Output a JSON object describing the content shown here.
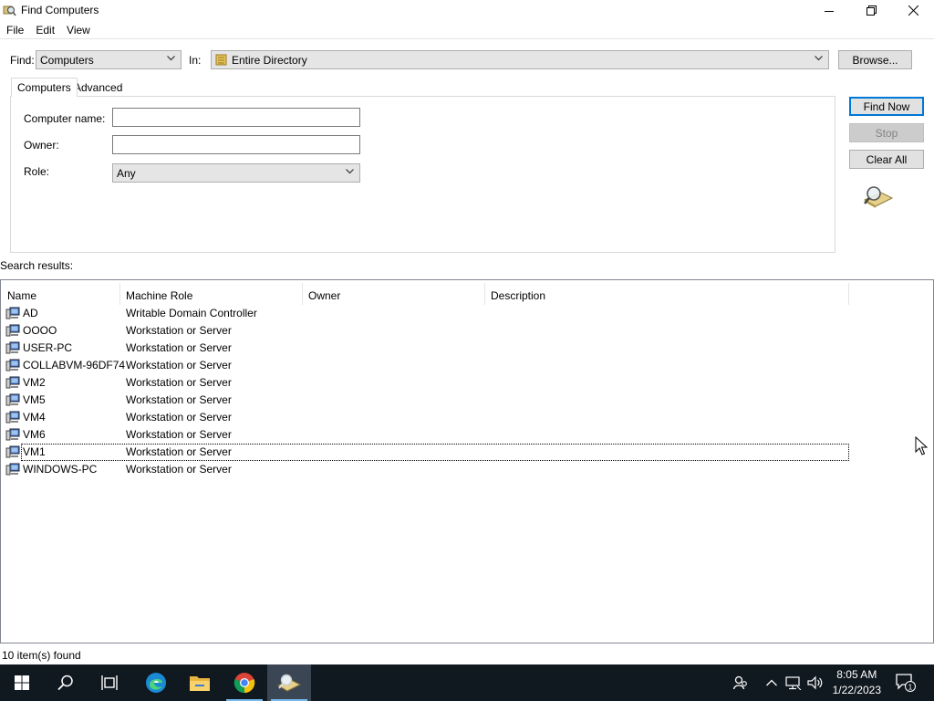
{
  "window": {
    "title": "Find Computers"
  },
  "menu": [
    "File",
    "Edit",
    "View"
  ],
  "find_row": {
    "find_label": "Find:",
    "find_value": "Computers",
    "in_label": "In:",
    "in_value": "Entire Directory",
    "browse_label": "Browse..."
  },
  "tabs": [
    "Computers",
    "Advanced"
  ],
  "form": {
    "computer_name_label": "Computer name:",
    "computer_name_value": "",
    "owner_label": "Owner:",
    "owner_value": "",
    "role_label": "Role:",
    "role_value": "Any"
  },
  "actions": {
    "find_now": "Find Now",
    "stop": "Stop",
    "clear_all": "Clear All"
  },
  "results": {
    "label": "Search results:",
    "columns": [
      "Name",
      "Machine Role",
      "Owner",
      "Description"
    ],
    "rows": [
      {
        "name": "AD",
        "role": "Writable Domain Controller"
      },
      {
        "name": "OOOO",
        "role": "Workstation or Server"
      },
      {
        "name": "USER-PC",
        "role": "Workstation or Server"
      },
      {
        "name": "COLLABVM-96DF74",
        "role": "Workstation or Server"
      },
      {
        "name": "VM2",
        "role": "Workstation or Server"
      },
      {
        "name": "VM5",
        "role": "Workstation or Server"
      },
      {
        "name": "VM4",
        "role": "Workstation or Server"
      },
      {
        "name": "VM6",
        "role": "Workstation or Server"
      },
      {
        "name": "VM1",
        "role": "Workstation or Server"
      },
      {
        "name": "WINDOWS-PC",
        "role": "Workstation or Server"
      }
    ],
    "status": "10 item(s) found"
  },
  "taskbar": {
    "time": "8:05 AM",
    "date": "1/22/2023",
    "notification_count": "1",
    "icons": [
      "windows-start-icon",
      "search-icon",
      "task-view-icon",
      "edge-icon",
      "file-explorer-icon",
      "chrome-icon",
      "find-computers-icon"
    ]
  },
  "colors": {
    "taskbar_bg": "#101820",
    "accent": "#0078d7"
  }
}
